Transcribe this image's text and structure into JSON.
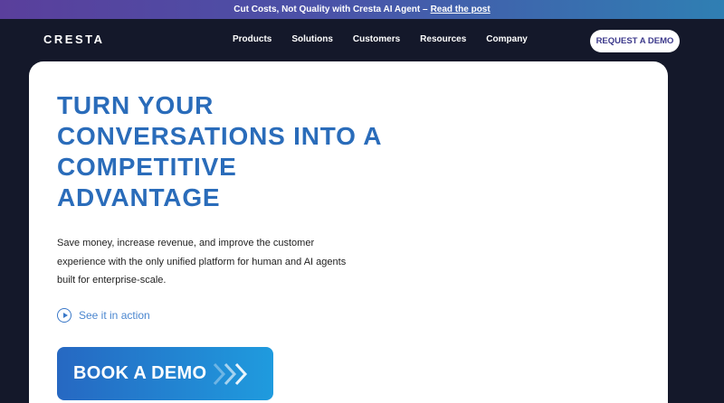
{
  "announcement": {
    "text": "Cut Costs, Not Quality with Cresta AI Agent –",
    "link": "Read the post"
  },
  "nav": {
    "logo": "CRESTA",
    "links": [
      "Products",
      "Solutions",
      "Customers",
      "Resources",
      "Company"
    ],
    "cta": "REQUEST A DEMO"
  },
  "hero": {
    "headline": "TURN YOUR CONVERSATIONS INTO A COMPETITIVE ADVANTAGE",
    "subtext": "Save money, increase revenue, and improve the customer experience with the only unified platform for human and AI agents built for enterprise-scale.",
    "action_link": "See it in action",
    "primary_button": "BOOK A DEMO"
  },
  "colors": {
    "background": "#14182a",
    "accent": "#2a6cba",
    "button_gradient_start": "#2668c2",
    "button_gradient_end": "#1f9bde"
  }
}
